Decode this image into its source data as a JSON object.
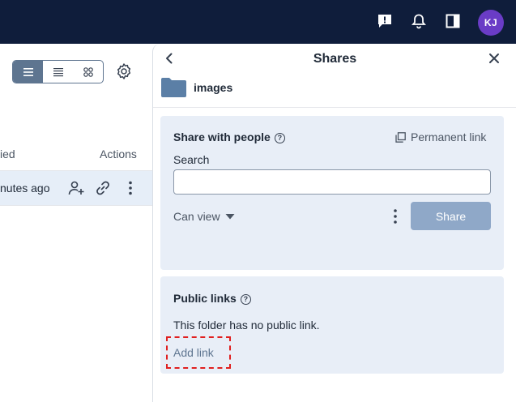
{
  "topbar": {
    "icons": [
      "notes-icon",
      "bell-icon",
      "sidebar-toggle-icon"
    ],
    "avatar_initials": "KJ",
    "avatar_color": "#6a3cc6",
    "background": "#0f1d3b"
  },
  "list": {
    "view_modes": [
      "list-icon",
      "compact-list-icon",
      "grid-icon"
    ],
    "active_view": "list",
    "columns": {
      "modified": "ied",
      "actions": "Actions"
    },
    "rows": [
      {
        "modified": "nutes ago",
        "actions": [
          "add-user-icon",
          "link-icon",
          "more-vertical-icon"
        ]
      }
    ]
  },
  "panel": {
    "title": "Shares",
    "folder_name": "images",
    "share_with_people": {
      "heading": "Share with people",
      "permanent_link": "Permanent link",
      "search_label": "Search",
      "search_value": "",
      "permission": "Can view",
      "share_button": "Share"
    },
    "public_links": {
      "heading": "Public links",
      "empty_text": "This folder has no public link.",
      "add_link": "Add link"
    }
  },
  "colors": {
    "accent": "#5e7590",
    "card_bg": "#e8eef7",
    "share_button_disabled": "#8fa8c8",
    "highlight_border": "#e02020"
  }
}
